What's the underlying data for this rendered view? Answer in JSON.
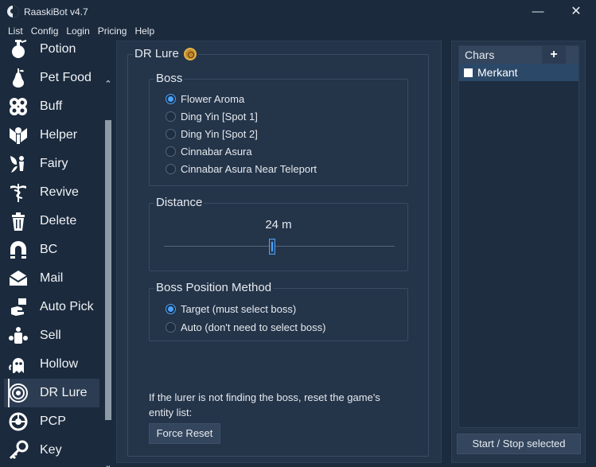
{
  "window": {
    "title": "RaaskiBot v4.7",
    "minimize_glyph": "—",
    "close_glyph": "✕"
  },
  "menu": [
    {
      "label": "List"
    },
    {
      "label": "Config"
    },
    {
      "label": "Login"
    },
    {
      "label": "Pricing"
    },
    {
      "label": "Help"
    }
  ],
  "sidebar": {
    "scroll_up": "⌃",
    "scroll_down": "⌄",
    "items": [
      {
        "label": "Potion",
        "icon": "potion-icon"
      },
      {
        "label": "Pet Food",
        "icon": "pear-icon"
      },
      {
        "label": "Buff",
        "icon": "swirl-icon"
      },
      {
        "label": "Helper",
        "icon": "helper-icon"
      },
      {
        "label": "Fairy",
        "icon": "fairy-icon"
      },
      {
        "label": "Revive",
        "icon": "caduceus-icon"
      },
      {
        "label": "Delete",
        "icon": "trash-icon"
      },
      {
        "label": "BC",
        "icon": "magnet-icon"
      },
      {
        "label": "Mail",
        "icon": "envelope-icon"
      },
      {
        "label": "Auto Pick",
        "icon": "pickup-hand-icon"
      },
      {
        "label": "Sell",
        "icon": "sell-icon"
      },
      {
        "label": "Hollow",
        "icon": "ghost-icon"
      },
      {
        "label": "DR Lure",
        "icon": "dr-lure-icon",
        "active": true
      },
      {
        "label": "PCP",
        "icon": "pcp-icon"
      },
      {
        "label": "Key",
        "icon": "key-icon"
      }
    ]
  },
  "main": {
    "title": "DR Lure",
    "boss": {
      "legend": "Boss",
      "options": [
        {
          "label": "Flower Aroma",
          "checked": true
        },
        {
          "label": "Ding Yin [Spot 1]",
          "checked": false
        },
        {
          "label": "Ding Yin [Spot 2]",
          "checked": false
        },
        {
          "label": "Cinnabar Asura",
          "checked": false
        },
        {
          "label": "Cinnabar Asura Near Teleport",
          "checked": false
        }
      ]
    },
    "distance": {
      "legend": "Distance",
      "value_text": "24 m",
      "value": 24
    },
    "position_method": {
      "legend": "Boss Position Method",
      "options": [
        {
          "label": "Target (must select boss)",
          "checked": true
        },
        {
          "label": "Auto (don't need to select boss)",
          "checked": false
        }
      ]
    },
    "note": "If the lurer is not finding the boss, reset the game's entity list:",
    "force_reset_label": "Force Reset"
  },
  "chars": {
    "title": "Chars",
    "add_label": "+",
    "items": [
      {
        "name": "Merkant",
        "checked": false
      }
    ],
    "start_stop_label": "Start / Stop selected"
  },
  "colors": {
    "background": "#1b2a3d",
    "panel": "#243449",
    "accent": "#4aa3ff",
    "selected_row": "#2b4868"
  }
}
